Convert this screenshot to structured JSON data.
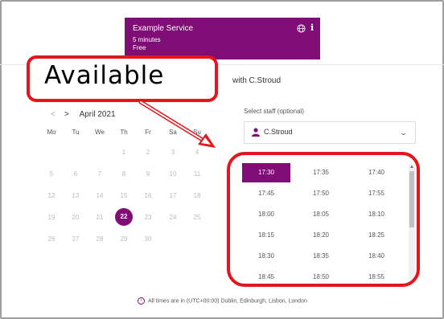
{
  "service": {
    "name": "Example Service",
    "duration": "5 minutes",
    "price": "Free",
    "info_label": "i"
  },
  "heading": "with C.Stroud",
  "calendar": {
    "month": "April 2021",
    "prev_label": "<",
    "next_label": ">",
    "weekdays": [
      "Mo",
      "Tu",
      "We",
      "Th",
      "Fr",
      "Sa",
      "Su"
    ],
    "weeks": [
      [
        "",
        "",
        "",
        "1",
        "2",
        "3",
        "4"
      ],
      [
        "5",
        "6",
        "7",
        "8",
        "9",
        "10",
        "11"
      ],
      [
        "12",
        "13",
        "14",
        "15",
        "16",
        "17",
        "18"
      ],
      [
        "19",
        "20",
        "21",
        "22",
        "23",
        "24",
        "25"
      ],
      [
        "26",
        "27",
        "28",
        "29",
        "30",
        "",
        ""
      ]
    ],
    "selected_day": "22"
  },
  "staff": {
    "label": "Select staff (optional)",
    "value": "C.Stroud"
  },
  "slots": [
    [
      "17:30",
      "17:35",
      "17:40"
    ],
    [
      "17:45",
      "17:50",
      "17:55"
    ],
    [
      "18:00",
      "18:05",
      "18:10"
    ],
    [
      "18:15",
      "18:20",
      "18:25"
    ],
    [
      "18:30",
      "18:35",
      "18:40"
    ],
    [
      "18:45",
      "18:50",
      "18:55"
    ]
  ],
  "selected_slot": "17:30",
  "timezone_note": "All times are in (UTC+00:00) Dublin, Edinburgh, Lisbon, London",
  "callout": {
    "text": "Available"
  },
  "colors": {
    "accent": "#7f0d75",
    "annotation": "#e6151b"
  }
}
